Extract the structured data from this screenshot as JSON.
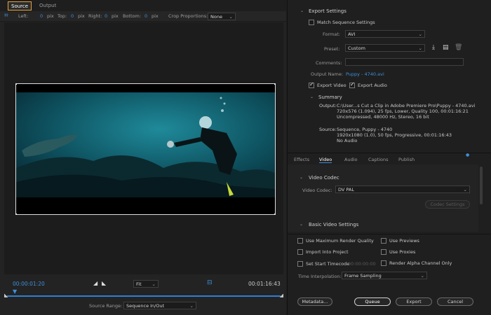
{
  "tabs": {
    "source": "Source",
    "output": "Output"
  },
  "crop": {
    "left_label": "Left:",
    "left_val": "0",
    "top_label": "Top:",
    "top_val": "0",
    "right_label": "Right:",
    "right_val": "0",
    "bottom_label": "Bottom:",
    "bottom_val": "0",
    "unit": "pix",
    "proportions_label": "Crop Proportions:",
    "proportions_val": "None"
  },
  "timeline": {
    "current_time": "00:00:01:20",
    "fit_label": "Fit",
    "end_time": "00:01:16:43",
    "source_range_label": "Source Range:",
    "source_range_val": "Sequence In/Out"
  },
  "export_settings": {
    "header": "Export Settings",
    "match_sequence": "Match Sequence Settings",
    "format_label": "Format:",
    "format_val": "AVI",
    "preset_label": "Preset:",
    "preset_val": "Custom",
    "comments_label": "Comments:",
    "output_name_label": "Output Name:",
    "output_name_val": "Puppy - 4740.avi",
    "export_video": "Export Video",
    "export_audio": "Export Audio"
  },
  "summary": {
    "header": "Summary",
    "output_label": "Output:",
    "output_lines": [
      "C:\\User...s Cut a Clip in Adobe Premiere Pro\\Puppy - 4740.avi",
      "720x576 (1.094), 25 fps, Lower, Quality 100, 00:01:16:21",
      "Uncompressed, 48000 Hz, Stereo, 16 bit"
    ],
    "source_label": "Source:",
    "source_lines": [
      "Sequence, Puppy - 4740",
      "1920x1080 (1.0), 50 fps, Progressive, 00:01:16:43",
      "No Audio"
    ]
  },
  "right_tabs": [
    "Effects",
    "Video",
    "Audio",
    "Captions",
    "Publish"
  ],
  "video_codec": {
    "header": "Video Codec",
    "codec_label": "Video Codec:",
    "codec_val": "DV PAL",
    "codec_settings": "Codec Settings",
    "basic_header": "Basic Video Settings"
  },
  "options": {
    "max_render": "Use Maximum Render Quality",
    "use_previews": "Use Previews",
    "import_project": "Import Into Project",
    "use_proxies": "Use Proxies",
    "set_start_tc": "Set Start Timecode",
    "start_tc_val": "00:00:00:00",
    "render_alpha": "Render Alpha Channel Only",
    "time_interp_label": "Time Interpolation:",
    "time_interp_val": "Frame Sampling"
  },
  "buttons": {
    "metadata": "Metadata...",
    "queue": "Queue",
    "export": "Export",
    "cancel": "Cancel"
  },
  "colors": {
    "accent": "#3d8fd8",
    "tab_highlight": "#e8a33a"
  }
}
